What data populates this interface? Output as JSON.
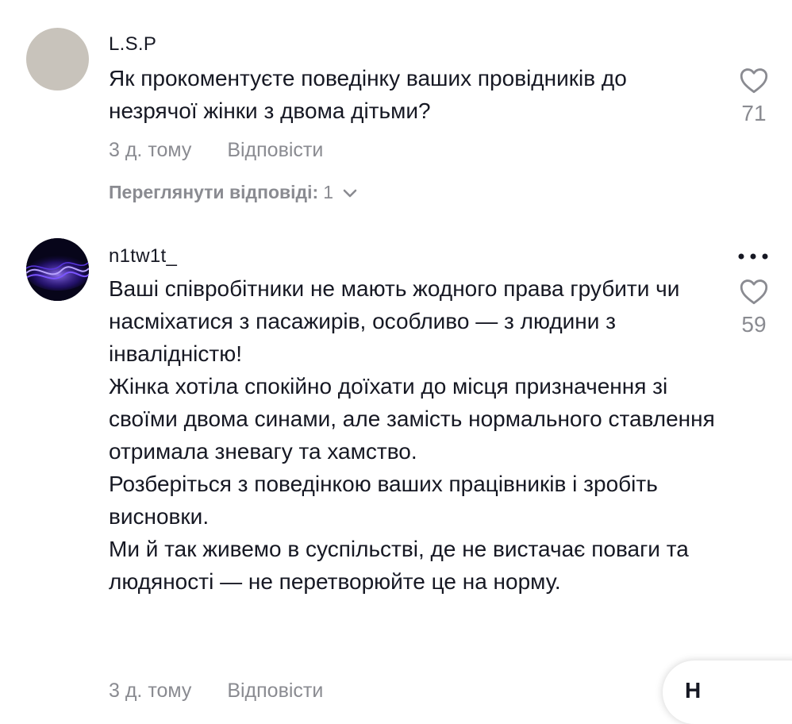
{
  "comments": [
    {
      "username": "L.S.P",
      "text": "Як прокоментуєте поведінку ваших провідників до незрячої жінки з двома дітьми?",
      "time": "3 д. тому",
      "reply_label": "Відповісти",
      "likes": "71",
      "view_replies_label": "Переглянути відповіді:",
      "view_replies_count": "1"
    },
    {
      "username": "n1tw1t_",
      "paragraphs": [
        "Ваші співробітники не мають жодного права грубити чи насміхатися з пасажирів, особливо — з людини з інвалідністю!",
        "Жінка хотіла спокійно доїхати до місця призначення зі своїми двома синами, але замість нормального ставлення отримала зневагу та хамство.",
        "Розберіться з поведінкою ваших працівників і зробіть висновки.",
        "Ми й так живемо в суспільстві, де не вистачає поваги та людяності — не перетворюйте це на норму."
      ],
      "time": "3 д. тому",
      "reply_label": "Відповісти",
      "likes": "59"
    }
  ],
  "floating_hint": "H",
  "colors": {
    "text": "#161823",
    "secondary": "#8a8b91",
    "avatar_1": "#c8c3bb",
    "avatar_2_accent": "#6a3cff"
  },
  "icons": [
    "heart-outline-icon",
    "more-dots-icon",
    "chevron-down-icon"
  ]
}
